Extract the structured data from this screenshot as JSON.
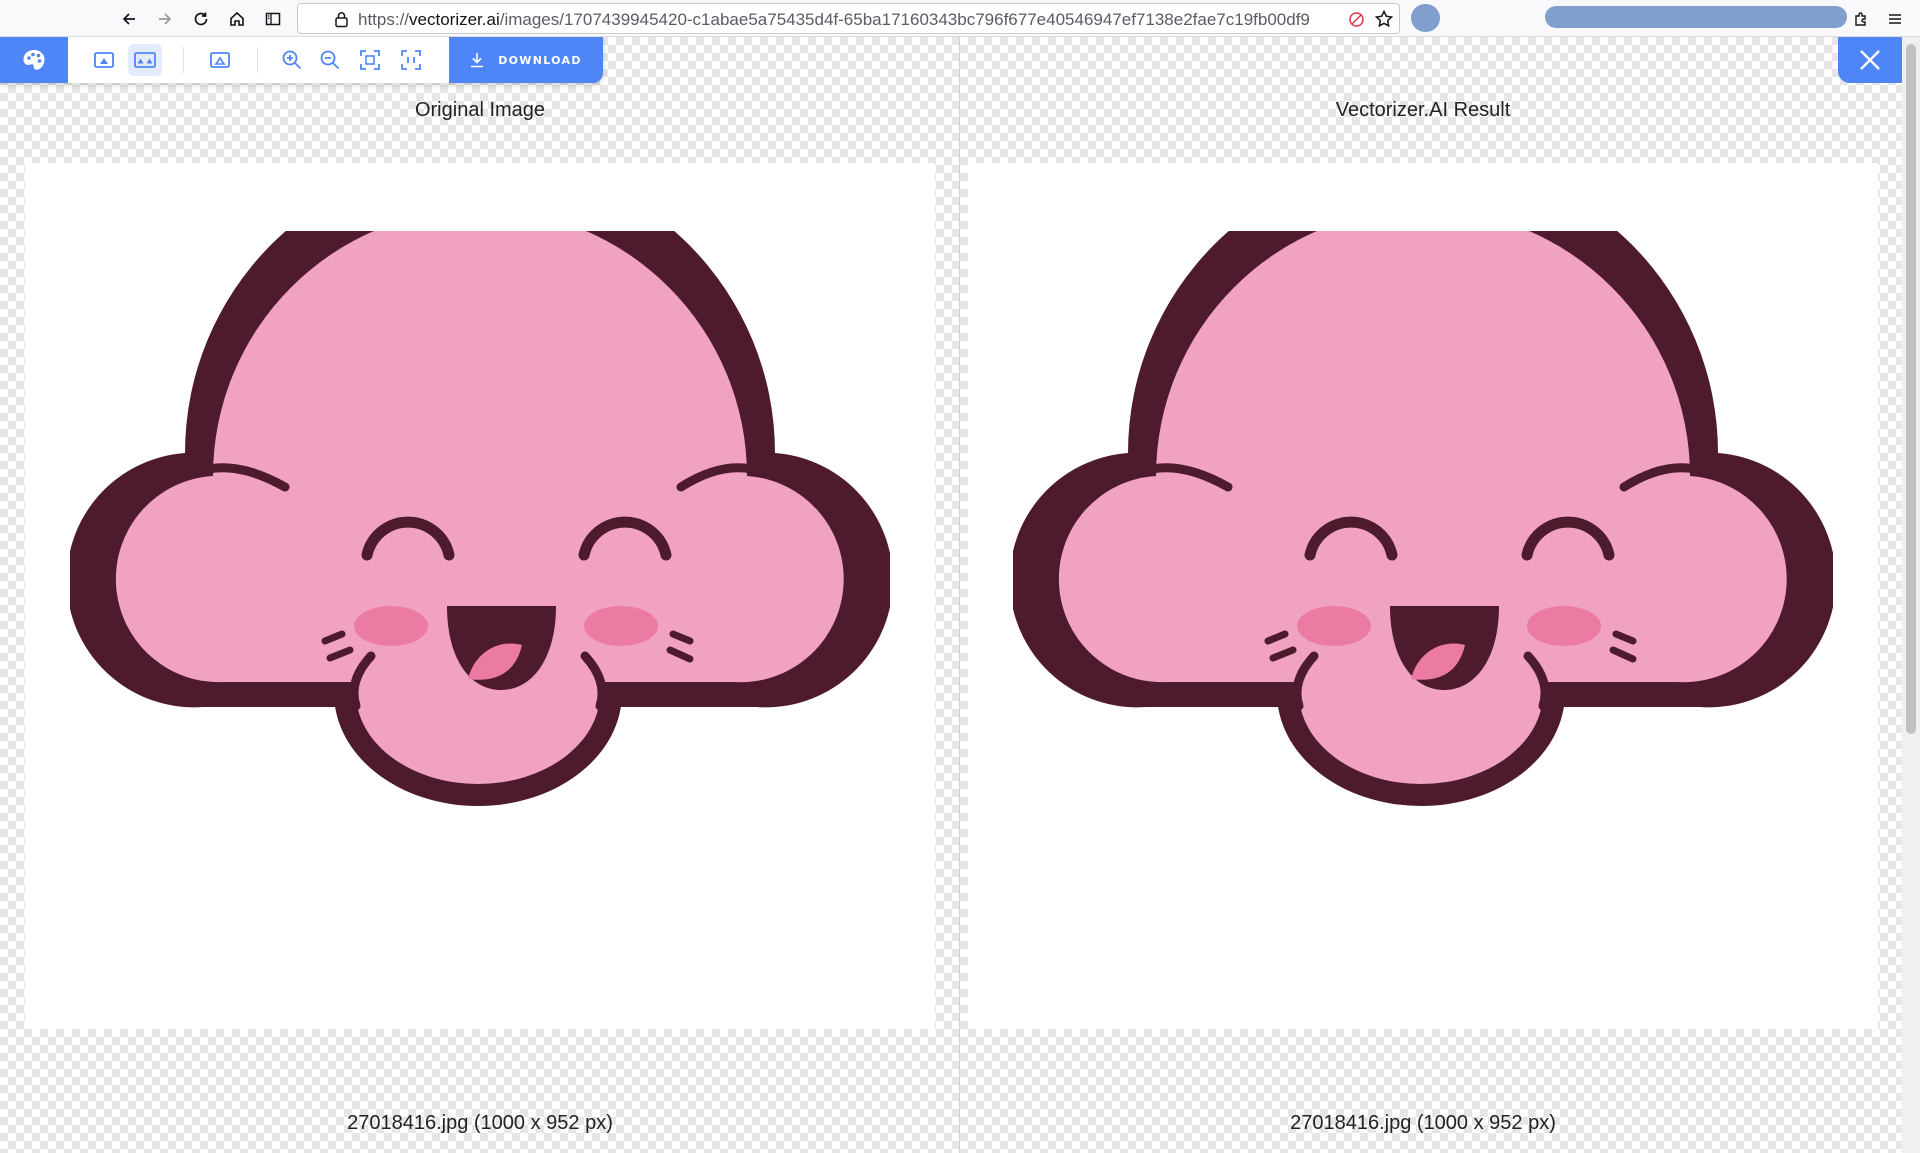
{
  "browser": {
    "url_prefix": "https://",
    "url_host": "vectorizer.ai",
    "url_path": "/images/1707439945420-c1abae5a75435d4f-65ba17160343bc796f677e40546947ef7138e2fae7c19fb00df9"
  },
  "toolbar": {
    "download_label": "DOWNLOAD"
  },
  "panes": [
    {
      "title": "Original Image",
      "caption": "27018416.jpg (1000 x 952 px)"
    },
    {
      "title": "Vectorizer.AI Result",
      "caption": "27018416.jpg (1000 x 952 px)"
    }
  ],
  "colors": {
    "accent": "#4f86f7",
    "cloud_fill": "#f1a2c2",
    "cloud_outline": "#4d1a2e",
    "cheek": "#ec7ba3"
  }
}
